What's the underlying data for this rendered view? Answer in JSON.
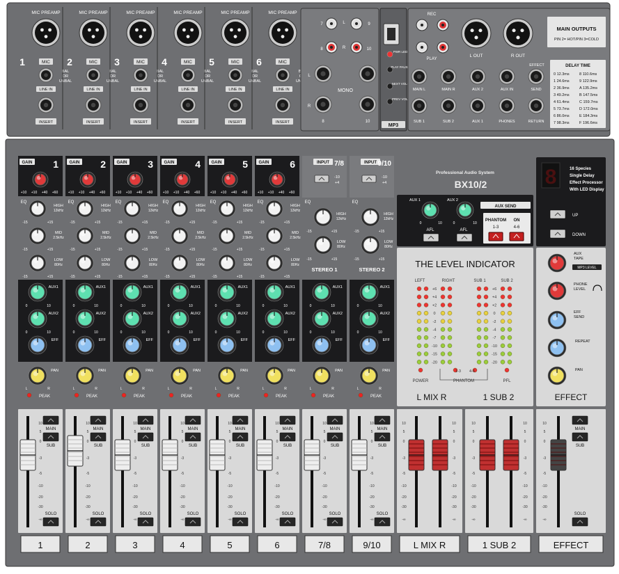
{
  "brand": {
    "tagline": "Professional Audio System",
    "model": "BX10/2"
  },
  "colors": {
    "panel": "#6e6f72",
    "dark": "#1b1b1d",
    "light_panel": "#d9d9d9",
    "knob_red": "#e03a3a",
    "knob_white": "#f2f2f2",
    "knob_green": "#5ee0b0",
    "knob_blue": "#8ec0f0",
    "knob_yellow": "#f0e060",
    "fader_red": "#c03030"
  },
  "top": {
    "mic_preamp_label": "MIC PREAMP",
    "mic_label": "MIC",
    "bal_unbal": [
      "BAL",
      "OR",
      "UNBAL"
    ],
    "line_in_label": "LINE IN",
    "insert_label": "INSERT",
    "mono_channels": [
      "1",
      "2",
      "3",
      "4",
      "5",
      "6"
    ],
    "stereo_pairs": [
      "7",
      "8",
      "9",
      "10"
    ],
    "mono_label": "MONO",
    "lr": [
      "L",
      "R"
    ],
    "mp3": {
      "label": "MP3",
      "buttons": [
        "PWR LED",
        "PLAY PAUSE",
        "NEXT VOL+",
        "PREV VOL-"
      ]
    },
    "rec_label": "REC",
    "play_label": "PLAY",
    "l_out": "L OUT",
    "r_out": "R OUT",
    "main_outputs": {
      "title": "MAIN OUTPUTS",
      "subtitle": "PIN 2= HOT/PIN 3=COLD"
    },
    "jacks": [
      "MAIN L",
      "MAIN R",
      "AUX 2",
      "AUX IN",
      "SEND",
      "SUB 1",
      "SUB 2",
      "AUX 1",
      "PHONES",
      "RETURN"
    ],
    "effect_label": "EFFECT",
    "delay_time": {
      "title": "DELAY TIME",
      "col1": [
        "0  12.3ms",
        "1  24.6ms",
        "2  36.9ms",
        "3  49.2ms",
        "4  61.4ms",
        "5  73.7ms",
        "6  86.0ms",
        "7  98.3ms"
      ],
      "col2": [
        "8  110.6ms",
        "9  122.9ms",
        "A  135.2ms",
        "B  147.5ms",
        "C  159.7ms",
        "D  172.0ms",
        "E  184.3ms",
        "F  196.6ms"
      ]
    }
  },
  "channels": {
    "mono_numbers": [
      "1",
      "2",
      "3",
      "4",
      "5",
      "6"
    ],
    "gain_label": "GAIN",
    "gain_scale": [
      "+10",
      "+10",
      "+40",
      "+60"
    ],
    "eq_label": "EQ",
    "high": [
      "HIGH",
      "12kHz"
    ],
    "mid": [
      "MID",
      "2.5kHz"
    ],
    "low": [
      "LOW",
      "80Hz"
    ],
    "range": [
      "-15",
      "+15"
    ],
    "aux1": "AUX1",
    "aux2": "AUX2",
    "eff": "EFF",
    "pan": "PAN",
    "peak": "PEAK",
    "zero_ten": [
      "0",
      "10"
    ],
    "stereo_inputs": [
      "7/8",
      "9/10"
    ],
    "input_label": "INPUT",
    "input_levels": [
      "-10",
      "+4"
    ],
    "stereo_names": [
      "STEREO 1",
      "STEREO 2"
    ]
  },
  "aux_section": {
    "aux1": "AUX 1",
    "aux2": "AUX 2",
    "afl": "AFL",
    "aux_send": "AUX SEND",
    "phantom": "PHANTOM",
    "on": "ON",
    "phantom_groups": [
      "1-3",
      "4-6"
    ]
  },
  "display": {
    "title_lines": [
      "16 Species",
      "Single Delay",
      "Effect Processor",
      "With LED Display"
    ],
    "up": "UP",
    "down": "DOWN",
    "digit": "8"
  },
  "level_indicator": {
    "title": "THE LEVEL INDICATOR",
    "left": "LEFT",
    "right": "RIGHT",
    "sub1": "SUB 1",
    "sub2": "SUB 2",
    "scale": [
      "+6",
      "+4",
      "+2",
      "0",
      "-2",
      "-4",
      "-7",
      "-10",
      "-15",
      "-20"
    ],
    "power": "POWER",
    "pfl": "PFL",
    "phantom": "PHANTOM",
    "groups": [
      "1-3",
      "4-6"
    ],
    "mix_label": "L  MIX  R",
    "sub_label": "1  SUB  2"
  },
  "effect_section": {
    "aux_tape": [
      "AUX",
      "TAPE"
    ],
    "mp3_level": "MP3 LEVEL",
    "phone_level": [
      "PHONE",
      "LEVEL"
    ],
    "eff_send": [
      "EFF",
      "SEND"
    ],
    "repeat": "REPEAT",
    "pan": "PAN",
    "title": "EFFECT"
  },
  "faders": {
    "scale": [
      "10",
      "5",
      "0",
      "-3",
      "-5",
      "-10",
      "-20",
      "-30",
      "-∞"
    ],
    "main": "MAIN",
    "sub": "SUB",
    "solo": "SOLO",
    "strip_labels": [
      "1",
      "2",
      "3",
      "4",
      "5",
      "6",
      "7/8",
      "9/10",
      "L  MIX  R",
      "1  SUB  2",
      "EFFECT"
    ]
  }
}
